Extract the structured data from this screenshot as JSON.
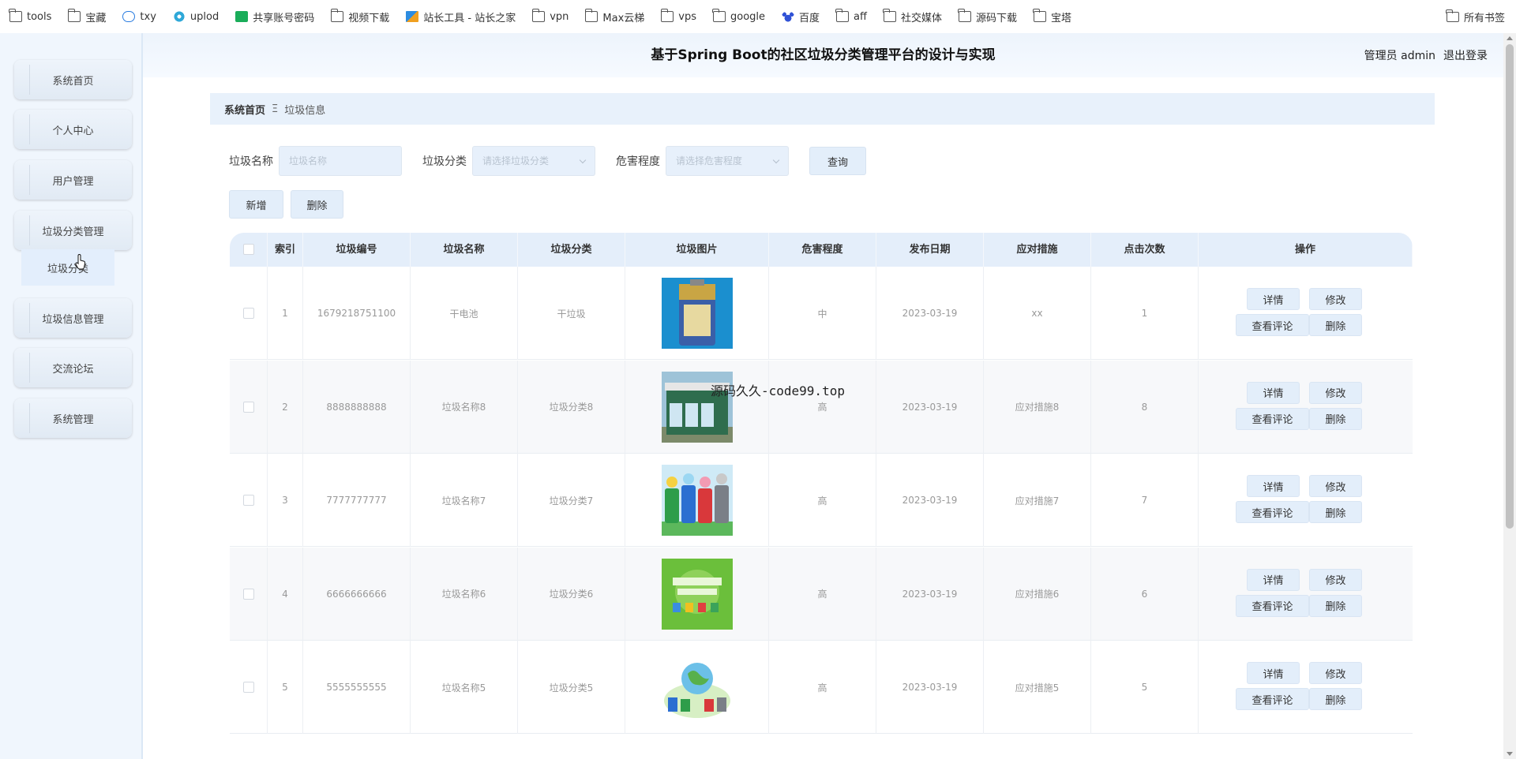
{
  "bookmarks": [
    {
      "label": "tools",
      "icon": "folder-icon"
    },
    {
      "label": "宝藏",
      "icon": "folder-icon"
    },
    {
      "label": "txy",
      "icon": "cloud-icon"
    },
    {
      "label": "uplod",
      "icon": "link-icon"
    },
    {
      "label": "共享账号密码",
      "icon": "sheet-icon"
    },
    {
      "label": "视频下载",
      "icon": "folder-icon"
    },
    {
      "label": "站长工具 - 站长之家",
      "icon": "tool-icon"
    },
    {
      "label": "vpn",
      "icon": "folder-icon"
    },
    {
      "label": "Max云梯",
      "icon": "folder-icon"
    },
    {
      "label": "vps",
      "icon": "folder-icon"
    },
    {
      "label": "google",
      "icon": "folder-icon"
    },
    {
      "label": "百度",
      "icon": "baidu-icon"
    },
    {
      "label": "aff",
      "icon": "folder-icon"
    },
    {
      "label": "社交媒体",
      "icon": "folder-icon"
    },
    {
      "label": "源码下载",
      "icon": "folder-icon"
    },
    {
      "label": "宝塔",
      "icon": "folder-icon"
    }
  ],
  "bookmarks_all": "所有书签",
  "sidebar": {
    "items": [
      {
        "label": "系统首页"
      },
      {
        "label": "个人中心"
      },
      {
        "label": "用户管理"
      },
      {
        "label": "垃圾分类管理"
      },
      {
        "label": "垃圾信息管理"
      },
      {
        "label": "交流论坛"
      },
      {
        "label": "系统管理"
      }
    ],
    "submenu_item": "垃圾分类"
  },
  "header": {
    "title": "基于Spring Boot的社区垃圾分类管理平台的设计与实现",
    "user": "管理员 admin",
    "logout": "退出登录"
  },
  "breadcrumb": {
    "home": "系统首页",
    "separator": "Ξ",
    "current": "垃圾信息"
  },
  "search": {
    "name_label": "垃圾名称",
    "name_placeholder": "垃圾名称",
    "category_label": "垃圾分类",
    "category_placeholder": "请选择垃圾分类",
    "hazard_label": "危害程度",
    "hazard_placeholder": "请选择危害程度",
    "query_button": "查询"
  },
  "actions": {
    "add": "新增",
    "delete": "删除"
  },
  "table": {
    "headers": [
      "索引",
      "垃圾编号",
      "垃圾名称",
      "垃圾分类",
      "垃圾图片",
      "危害程度",
      "发布日期",
      "应对措施",
      "点击次数",
      "操作"
    ],
    "row_actions": {
      "detail": "详情",
      "edit": "修改",
      "comments": "查看评论",
      "delete": "删除"
    },
    "rows": [
      {
        "index": "1",
        "code": "1679218751100",
        "name": "干电池",
        "category": "干垃圾",
        "image": "battery-image",
        "hazard": "中",
        "date": "2023-03-19",
        "measure": "xx",
        "clicks": "1"
      },
      {
        "index": "2",
        "code": "8888888888",
        "name": "垃圾名称8",
        "category": "垃圾分类8",
        "image": "recycling-station-image",
        "hazard": "高",
        "date": "2023-03-19",
        "measure": "应对措施8",
        "clicks": "8"
      },
      {
        "index": "3",
        "code": "7777777777",
        "name": "垃圾名称7",
        "category": "垃圾分类7",
        "image": "bins-cartoon-image",
        "hazard": "高",
        "date": "2023-03-19",
        "measure": "应对措施7",
        "clicks": "7"
      },
      {
        "index": "4",
        "code": "6666666666",
        "name": "垃圾名称6",
        "category": "垃圾分类6",
        "image": "green-poster-image",
        "hazard": "高",
        "date": "2023-03-19",
        "measure": "应对措施6",
        "clicks": "6"
      },
      {
        "index": "5",
        "code": "5555555555",
        "name": "垃圾名称5",
        "category": "垃圾分类5",
        "image": "earth-bins-image",
        "hazard": "高",
        "date": "2023-03-19",
        "measure": "应对措施5",
        "clicks": "5"
      }
    ]
  },
  "watermark": "源码久久-code99.top",
  "colors": {
    "accent_bg": "#e3eefa",
    "sidebar_bg": "#f0f6fd",
    "header_bg": "#edf4fc"
  }
}
